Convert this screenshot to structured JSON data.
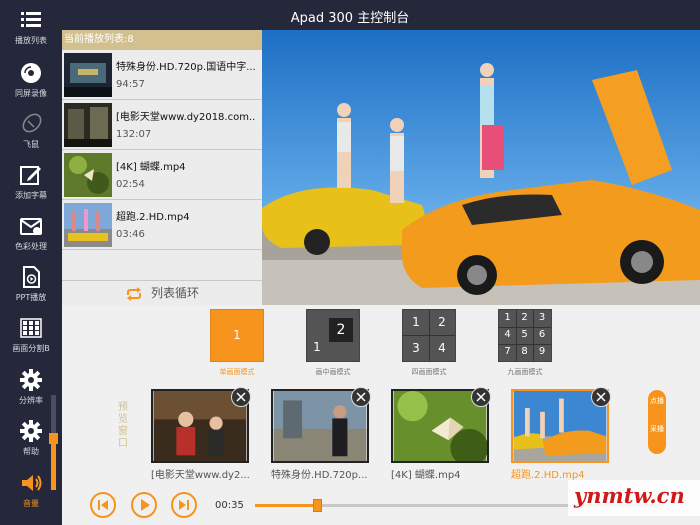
{
  "app": {
    "title": "Apad 300 主控制台"
  },
  "sidebar": {
    "items": [
      {
        "label": "播放列表",
        "icon": "list-icon"
      },
      {
        "label": "同屏录像",
        "icon": "disc-icon"
      },
      {
        "label": "飞鼠",
        "icon": "air-mouse-icon"
      },
      {
        "label": "添加字幕",
        "icon": "edit-icon"
      },
      {
        "label": "色彩处理",
        "icon": "color-icon"
      },
      {
        "label": "PPT播放",
        "icon": "ppt-icon"
      },
      {
        "label": "画面分割B",
        "icon": "grid-icon"
      },
      {
        "label": "分辨率",
        "icon": "gear-icon"
      },
      {
        "label": "帮助",
        "icon": "help-gear-icon"
      },
      {
        "label": "音量",
        "icon": "volume-icon"
      }
    ],
    "volume_level": 0.55
  },
  "playlist": {
    "header": "当前播放列表:8",
    "items": [
      {
        "name": "特殊身份.HD.720p.国语中字...",
        "duration": "94:57"
      },
      {
        "name": "[电影天堂www.dy2018.com...",
        "duration": "132:07"
      },
      {
        "name": "[4K] 蝴蝶.mp4",
        "duration": "02:54"
      },
      {
        "name": "超跑.2.HD.mp4",
        "duration": "03:46"
      }
    ],
    "loop_label": "列表循环"
  },
  "layouts": {
    "options": [
      {
        "label": "单画面模式",
        "cells": [
          "1"
        ]
      },
      {
        "label": "画中画模式",
        "cells": [
          "1",
          "2"
        ]
      },
      {
        "label": "四画面模式",
        "cells": [
          "1",
          "2",
          "3",
          "4"
        ]
      },
      {
        "label": "九画面模式",
        "cells": [
          "1",
          "2",
          "3",
          "4",
          "5",
          "6",
          "7",
          "8",
          "9"
        ]
      }
    ],
    "selected": 0
  },
  "preview": {
    "label": "预览窗口",
    "items": [
      {
        "name": "[电影天堂www.dy2..."
      },
      {
        "name": "特殊身份.HD.720p..."
      },
      {
        "name": "[4K] 蝴蝶.mp4"
      },
      {
        "name": "超跑.2.HD.mp4"
      }
    ],
    "selected": 3,
    "mode_on": "点播",
    "mode_off": "采播"
  },
  "transport": {
    "elapsed": "00:35",
    "progress": 0.15
  },
  "watermark": "ynmtw.cn",
  "colors": {
    "accent": "#f7941d",
    "sidebar_bg": "#25283a",
    "header_tan": "#d3c08f"
  }
}
